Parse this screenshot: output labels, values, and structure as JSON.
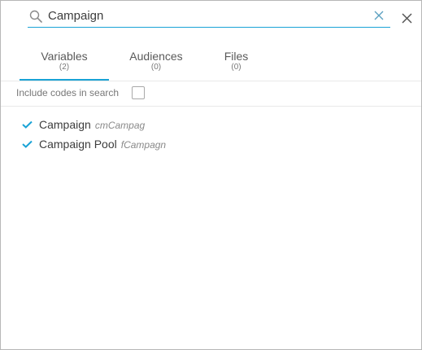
{
  "search": {
    "value": "Campaign",
    "accent_color": "#1aa3d6"
  },
  "tabs": [
    {
      "label": "Variables",
      "count": "(2)",
      "active": true
    },
    {
      "label": "Audiences",
      "count": "(0)",
      "active": false
    },
    {
      "label": "Files",
      "count": "(0)",
      "active": false
    }
  ],
  "options": {
    "include_codes_label": "Include codes in search",
    "include_codes_checked": false
  },
  "results": [
    {
      "name": "Campaign",
      "code": "cmCampag",
      "checked": true
    },
    {
      "name": "Campaign Pool",
      "code": "fCampagn",
      "checked": true
    }
  ]
}
